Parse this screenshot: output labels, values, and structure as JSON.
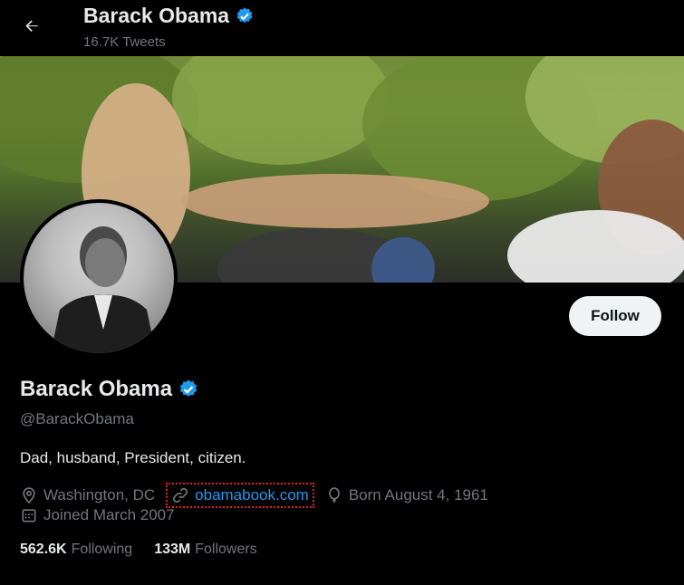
{
  "header": {
    "name": "Barack Obama",
    "tweet_count": "16.7K Tweets"
  },
  "profile": {
    "display_name": "Barack Obama",
    "handle": "@BarackObama",
    "bio": "Dad, husband, President, citizen.",
    "location": "Washington, DC",
    "website": "obamabook.com",
    "born": "Born August 4, 1961",
    "joined": "Joined March 2007"
  },
  "stats": {
    "following_count": "562.6K",
    "following_label": "Following",
    "followers_count": "133M",
    "followers_label": "Followers"
  },
  "actions": {
    "follow_label": "Follow"
  },
  "colors": {
    "accent": "#1d9bf0",
    "background": "#000000",
    "verified": "#1d9bf0",
    "link_outline": "#dd2222"
  },
  "icons": [
    "back-arrow-icon",
    "verified-badge-icon",
    "location-pin-icon",
    "link-icon",
    "balloon-icon",
    "calendar-icon"
  ]
}
